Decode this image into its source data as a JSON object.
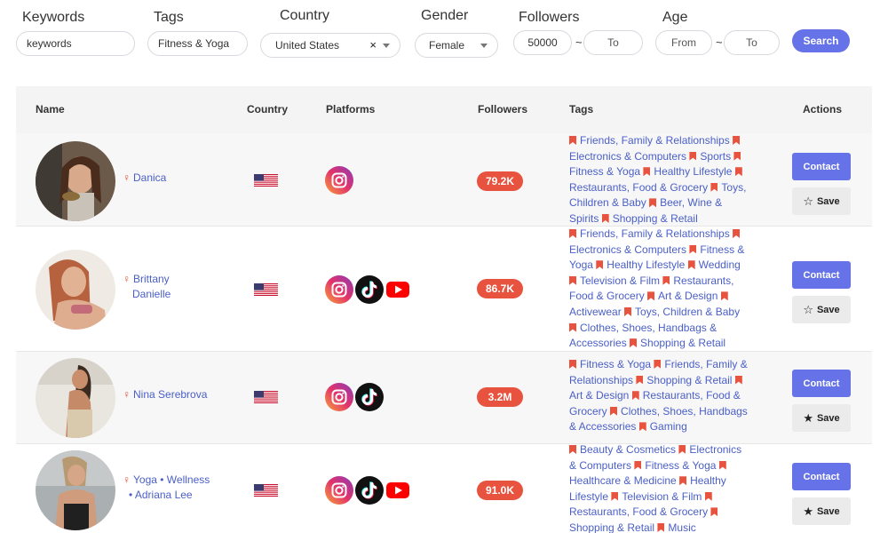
{
  "filters": {
    "keywords": {
      "label": "Keywords",
      "value": "keywords"
    },
    "tags": {
      "label": "Tags",
      "value": "Fitness & Yoga"
    },
    "country": {
      "label": "Country",
      "value": "United States",
      "clear": "×"
    },
    "gender": {
      "label": "Gender",
      "value": "Female"
    },
    "followers": {
      "label": "Followers",
      "from": "50000",
      "to": "To",
      "sep": "~"
    },
    "age": {
      "label": "Age",
      "from": "From",
      "to": "To",
      "sep": "~"
    },
    "search_label": "Search"
  },
  "table": {
    "headers": {
      "name": "Name",
      "country": "Country",
      "platforms": "Platforms",
      "followers": "Followers",
      "tags": "Tags",
      "actions": "Actions"
    },
    "contact_label": "Contact",
    "save_label": "Save",
    "rows": [
      {
        "name_lines": [
          "Danica"
        ],
        "platforms": [
          "instagram-icon"
        ],
        "followers": "79.2K",
        "saved": false,
        "tags": [
          "Friends, Family & Relationships",
          "Electronics & Computers",
          "Sports",
          "Fitness & Yoga",
          "Healthy Lifestyle",
          "Restaurants, Food & Grocery",
          "Toys, Children & Baby",
          "Beer, Wine & Spirits",
          "Shopping & Retail"
        ]
      },
      {
        "name_lines": [
          "Brittany",
          "Danielle"
        ],
        "platforms": [
          "instagram-icon",
          "tiktok-icon",
          "youtube-icon"
        ],
        "followers": "86.7K",
        "saved": false,
        "tags": [
          "Friends, Family & Relationships",
          "Electronics & Computers",
          "Fitness & Yoga",
          "Healthy Lifestyle",
          "Wedding",
          "Television & Film",
          "Restaurants, Food & Grocery",
          "Art & Design",
          "Activewear",
          "Toys, Children & Baby",
          "Clothes, Shoes, Handbags & Accessories",
          "Shopping & Retail"
        ]
      },
      {
        "name_lines": [
          "Nina Serebrova"
        ],
        "platforms": [
          "instagram-icon",
          "tiktok-icon"
        ],
        "followers": "3.2M",
        "saved": true,
        "tags": [
          "Fitness & Yoga",
          "Friends, Family & Relationships",
          "Shopping & Retail",
          "Art & Design",
          "Restaurants, Food & Grocery",
          "Clothes, Shoes, Handbags & Accessories",
          "Gaming"
        ]
      },
      {
        "name_lines": [
          "Yoga • Wellness",
          "• Adriana Lee"
        ],
        "platforms": [
          "instagram-icon",
          "tiktok-icon",
          "youtube-icon"
        ],
        "followers": "91.0K",
        "saved": true,
        "tags": [
          "Beauty & Cosmetics",
          "Electronics & Computers",
          "Fitness & Yoga",
          "Healthcare & Medicine",
          "Healthy Lifestyle",
          "Television & Film",
          "Restaurants, Food & Grocery",
          "Shopping & Retail",
          "Music"
        ]
      }
    ]
  }
}
